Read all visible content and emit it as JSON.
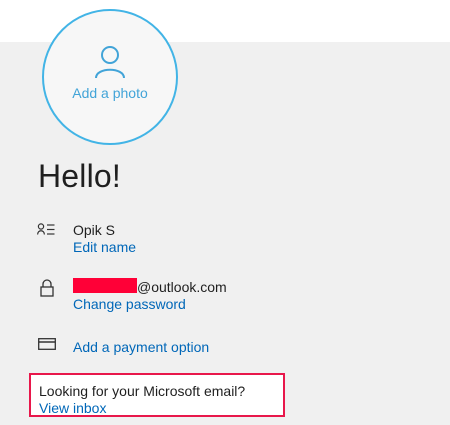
{
  "avatar": {
    "add_photo_label": "Add a photo"
  },
  "greeting": "Hello!",
  "profile": {
    "name": "Opik S",
    "edit_name_link": "Edit name"
  },
  "account": {
    "email_suffix": "@outlook.com",
    "change_password_link": "Change password"
  },
  "payment": {
    "add_payment_link": "Add a payment option"
  },
  "email_prompt": {
    "question": "Looking for your Microsoft email?",
    "view_inbox_link": "View inbox"
  },
  "colors": {
    "accent": "#42b4e6",
    "link": "#0067b8",
    "highlight": "#e8174b",
    "redaction": "#ff0037"
  },
  "icons": [
    "person-icon",
    "contact-card-icon",
    "lock-icon",
    "credit-card-icon"
  ]
}
